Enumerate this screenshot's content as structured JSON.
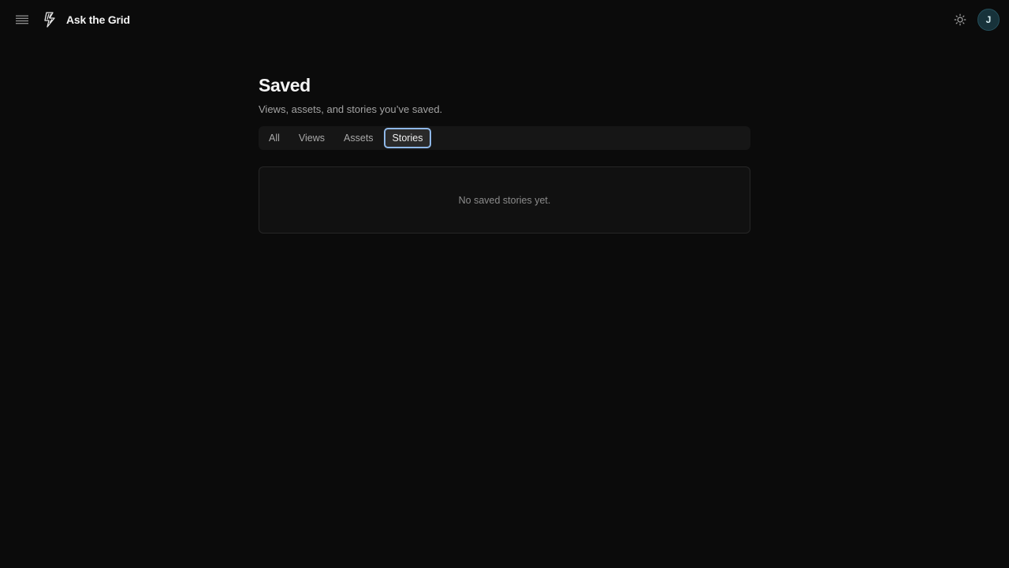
{
  "header": {
    "app_name": "Ask the Grid",
    "menu_icon": "menu-icon",
    "logo_icon": "lightning-logo-icon",
    "theme_icon": "sun-icon",
    "avatar_initial": "J"
  },
  "page": {
    "title": "Saved",
    "subtitle": "Views, assets, and stories you’ve saved."
  },
  "tabs": [
    {
      "label": "All",
      "active": false
    },
    {
      "label": "Views",
      "active": false
    },
    {
      "label": "Assets",
      "active": false
    },
    {
      "label": "Stories",
      "active": true
    }
  ],
  "empty_state": {
    "message": "No saved stories yet."
  },
  "colors": {
    "background": "#0b0b0b",
    "accent_focus": "#8fb8e8",
    "avatar_bg": "#17323a"
  }
}
